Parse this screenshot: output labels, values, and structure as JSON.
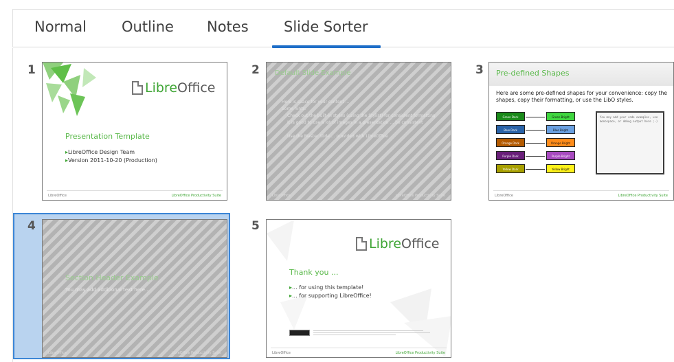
{
  "tabs": {
    "normal": "Normal",
    "outline": "Outline",
    "notes": "Notes",
    "slide_sorter": "Slide Sorter",
    "active": "Slide Sorter"
  },
  "colors": {
    "accent": "#1e6ec8",
    "libre_green": "#3fa535",
    "selection": "#b9d3ef"
  },
  "slides": [
    {
      "number": "1",
      "logo_libre": "Libre",
      "logo_office": "Office",
      "title": "Presentation Template",
      "bullets": [
        "LibreOffice Design Team",
        "Version 2011-10-20 (Production)"
      ],
      "footer_left": "LibreOffice",
      "footer_right": "LibreOffice Productivity Suite"
    },
    {
      "number": "2",
      "title": "Default Slide Example",
      "bullets": [
        "Here is space for your content ...",
        "Some hints:",
        "Check out the built-in styles (using the Stylist) for consistent formatting",
        "It is good to use a lot of images in a presentation ... be consistent",
        "Use the Master Slide ... provided with LibreOffice"
      ],
      "footer_left": "LibreOffice",
      "footer_right": "LibreOffice Productivity Suite"
    },
    {
      "number": "3",
      "title": "Pre-defined Shapes",
      "body": "Here are some pre-defined shapes for your convenience: copy the shapes, copy their formatting, or use the LibO styles.",
      "shapes_left": [
        {
          "label": "Green Dark",
          "color": "#1a8a1a"
        },
        {
          "label": "Blue Dark",
          "color": "#2a63a8"
        },
        {
          "label": "Orange Dark",
          "color": "#b35a00"
        },
        {
          "label": "Purple Dark",
          "color": "#6a1f7a"
        },
        {
          "label": "Yellow Dark",
          "color": "#a8a000"
        }
      ],
      "shapes_right": [
        {
          "label": "Green Bright",
          "color": "#3fd63f"
        },
        {
          "label": "Blue Bright",
          "color": "#6aa0e0"
        },
        {
          "label": "Orange Bright",
          "color": "#ff8c1a"
        },
        {
          "label": "Purple Bright",
          "color": "#a84ac0"
        },
        {
          "label": "Yellow Bright",
          "color": "#fff21a"
        }
      ],
      "code_text": "You may add your code examples, use monospace, or debug output here ;-)",
      "footer_left": "LibreOffice",
      "footer_right": "LibreOffice Productivity Suite"
    },
    {
      "number": "4",
      "title": "Section Header Example",
      "subtitle": "You may add additional text here...",
      "footer_left": "LibreOffice",
      "footer_right": "LibreOffice Productivity Suite"
    },
    {
      "number": "5",
      "logo_libre": "Libre",
      "logo_office": "Office",
      "title": "Thank you ...",
      "bullets": [
        "... for using this template!",
        "... for supporting LibreOffice!"
      ],
      "footer_left": "LibreOffice",
      "footer_right": "LibreOffice Productivity Suite"
    }
  ]
}
